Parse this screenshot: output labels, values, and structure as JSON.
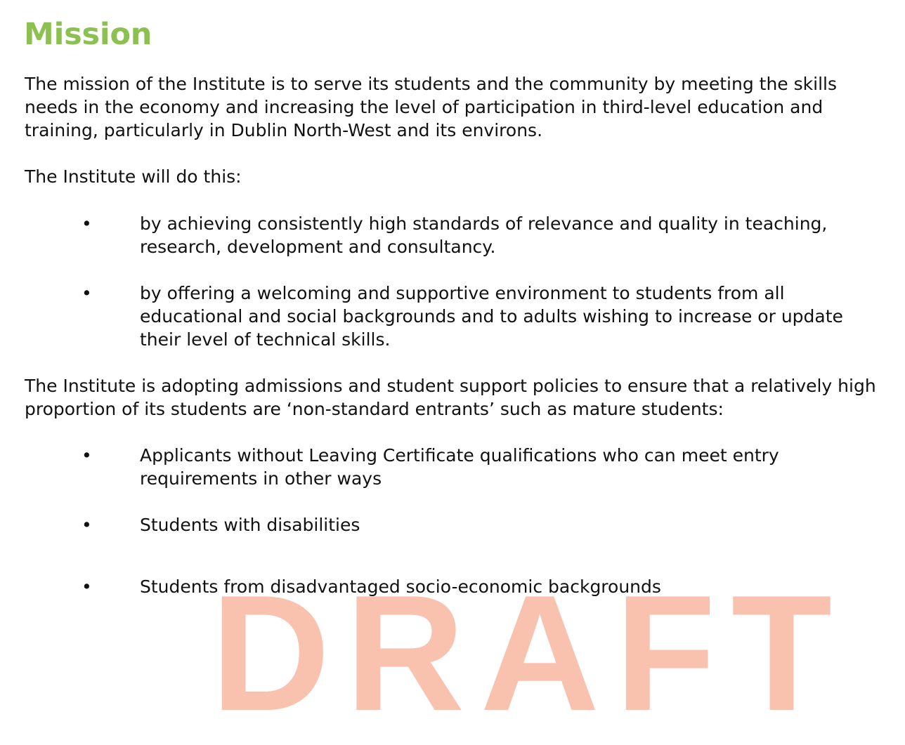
{
  "document": {
    "title": "Mission",
    "paragraphs": {
      "mission": "The mission of the Institute is to serve its students and the community by meeting the skills needs in the economy and increasing the level of participation in third-level education and training, particularly in Dublin North-West and its environs.",
      "will_do": "The Institute will do this:",
      "admissions": "The Institute is adopting admissions and student support policies to ensure that a relatively high proportion of its students are ‘non-standard entrants’ such as mature students:"
    },
    "bullet_symbol": "•",
    "will_do_items": [
      "by achieving consistently high standards of relevance and quality in teaching, research, development and consultancy.",
      "by offering a welcoming and supportive environment to students from all educational and social backgrounds and to adults wishing to increase or update their level of technical skills."
    ],
    "entrant_items": [
      "Applicants without Leaving Certificate qualifications who can meet entry requirements in other ways",
      "Students with disabilities",
      "Students from disadvantaged socio-economic backgrounds"
    ],
    "watermark": "DRAFT",
    "colors": {
      "title": "#8cc152",
      "text": "#111111",
      "watermark": "#f9b8a0"
    }
  }
}
